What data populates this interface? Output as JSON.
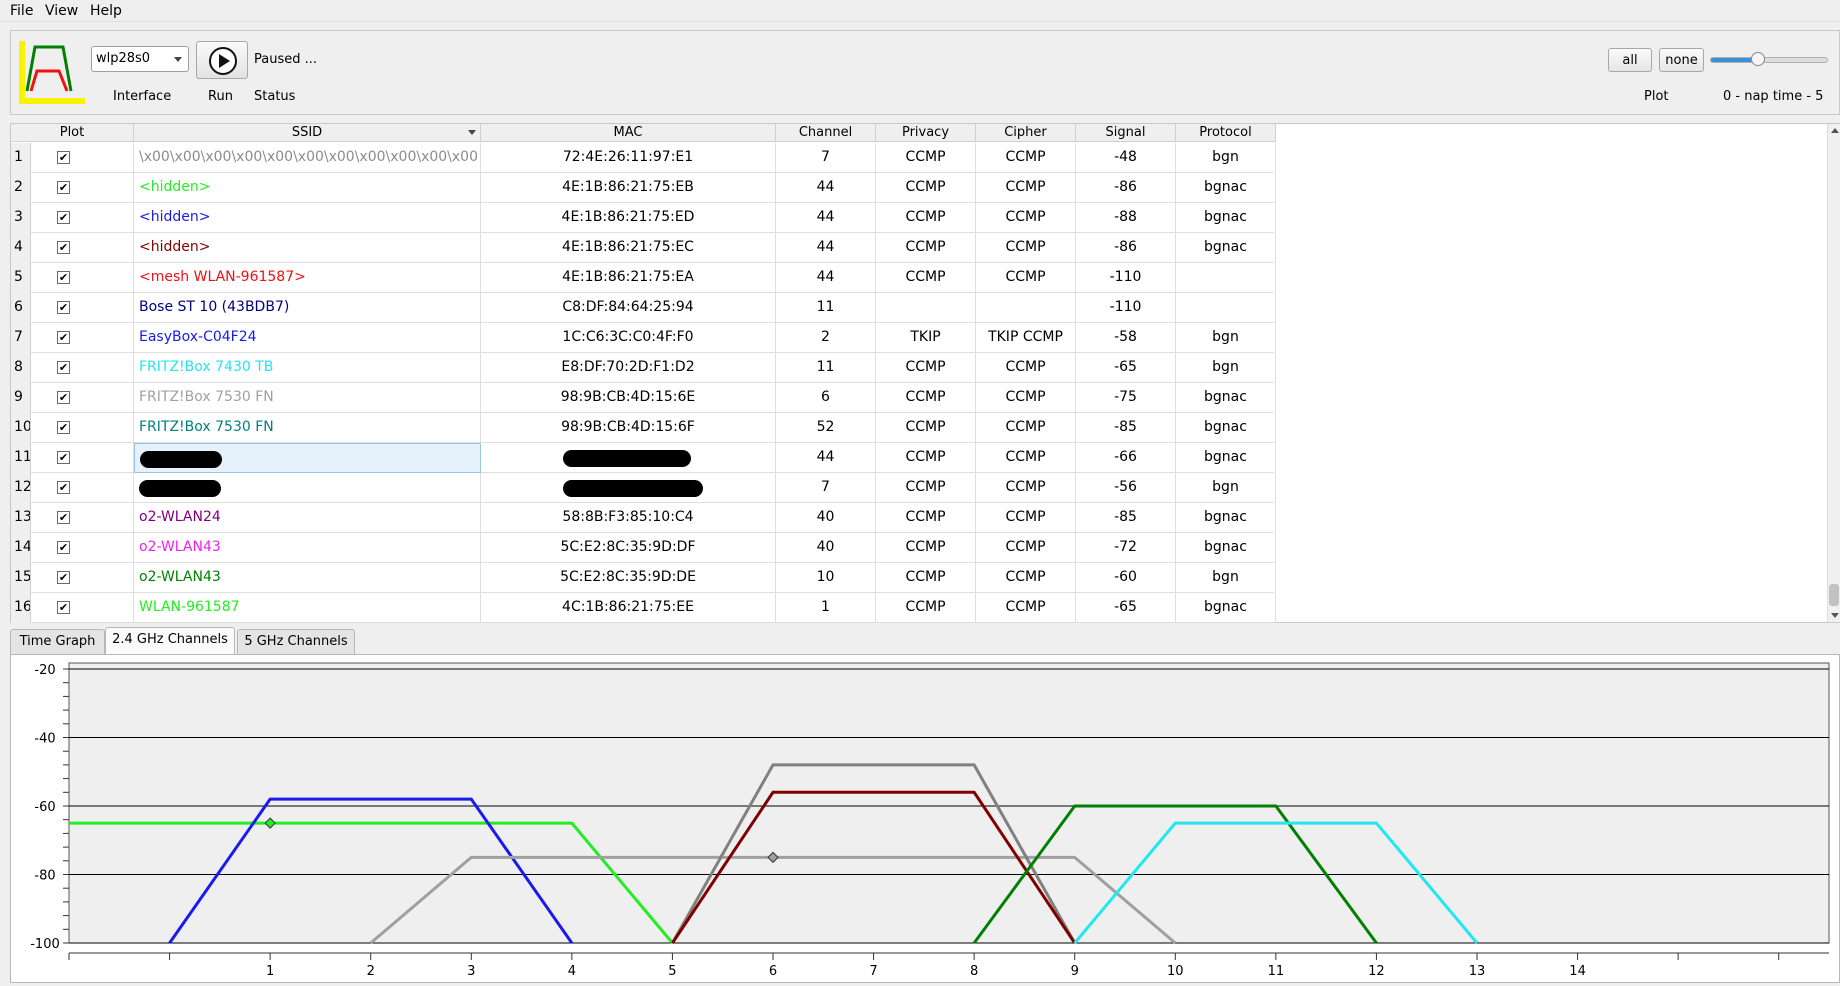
{
  "menu": {
    "file": "File",
    "view": "View",
    "help": "Help"
  },
  "toolbar": {
    "interface_value": "wlp28s0",
    "interface_label": "Interface",
    "run_label": "Run",
    "status_value": "Paused ...",
    "status_label": "Status",
    "all_label": "all",
    "none_label": "none",
    "plot_label": "Plot",
    "nap_time_label": "0 - nap time - 5",
    "nap_time_level": 0.35
  },
  "table": {
    "headers": [
      "Plot",
      "SSID",
      "MAC",
      "Channel",
      "Privacy",
      "Cipher",
      "Signal",
      "Protocol"
    ],
    "rows": [
      {
        "num": "1",
        "ssid": "\\x00\\x00\\x00\\x00\\x00\\x00\\x00\\x00\\x00\\x00\\x00",
        "mac": "72:4E:26:11:97:E1",
        "channel": "7",
        "privacy": "CCMP",
        "cipher": "CCMP",
        "signal": "-48",
        "protocol": "bgn",
        "color": "#8c8c8c"
      },
      {
        "num": "2",
        "ssid": "<hidden>",
        "mac": "4E:1B:86:21:75:EB",
        "channel": "44",
        "privacy": "CCMP",
        "cipher": "CCMP",
        "signal": "-86",
        "protocol": "bgnac",
        "color": "#22ee22"
      },
      {
        "num": "3",
        "ssid": "<hidden>",
        "mac": "4E:1B:86:21:75:ED",
        "channel": "44",
        "privacy": "CCMP",
        "cipher": "CCMP",
        "signal": "-88",
        "protocol": "bgnac",
        "color": "#1a1aee"
      },
      {
        "num": "4",
        "ssid": "<hidden>",
        "mac": "4E:1B:86:21:75:EC",
        "channel": "44",
        "privacy": "CCMP",
        "cipher": "CCMP",
        "signal": "-86",
        "protocol": "bgnac",
        "color": "#800000"
      },
      {
        "num": "5",
        "ssid": "<mesh WLAN-961587>",
        "mac": "4E:1B:86:21:75:EA",
        "channel": "44",
        "privacy": "CCMP",
        "cipher": "CCMP",
        "signal": "-110",
        "protocol": "",
        "color": "#ee1111"
      },
      {
        "num": "6",
        "ssid": "Bose ST 10 (43BDB7)",
        "mac": "C8:DF:84:64:25:94",
        "channel": "11",
        "privacy": "",
        "cipher": "",
        "signal": "-110",
        "protocol": "",
        "color": "#000080"
      },
      {
        "num": "7",
        "ssid": "EasyBox-C04F24",
        "mac": "1C:C6:3C:C0:4F:F0",
        "channel": "2",
        "privacy": "TKIP",
        "cipher": "TKIP CCMP",
        "signal": "-58",
        "protocol": "bgn",
        "color": "#1a1aee"
      },
      {
        "num": "8",
        "ssid": "FRITZ!Box 7430 TB",
        "mac": "E8:DF:70:2D:F1:D2",
        "channel": "11",
        "privacy": "CCMP",
        "cipher": "CCMP",
        "signal": "-65",
        "protocol": "bgn",
        "color": "#22e6f0"
      },
      {
        "num": "9",
        "ssid": "FRITZ!Box 7530 FN",
        "mac": "98:9B:CB:4D:15:6E",
        "channel": "6",
        "privacy": "CCMP",
        "cipher": "CCMP",
        "signal": "-75",
        "protocol": "bgnac",
        "color": "#a0a0a0"
      },
      {
        "num": "10",
        "ssid": "FRITZ!Box 7530 FN",
        "mac": "98:9B:CB:4D:15:6F",
        "channel": "52",
        "privacy": "CCMP",
        "cipher": "CCMP",
        "signal": "-85",
        "protocol": "bgnac",
        "color": "#008080"
      },
      {
        "num": "11",
        "ssid": "",
        "mac": "",
        "channel": "44",
        "privacy": "CCMP",
        "cipher": "CCMP",
        "signal": "-66",
        "protocol": "bgnac",
        "color": "#000000"
      },
      {
        "num": "12",
        "ssid": "",
        "mac": "",
        "channel": "7",
        "privacy": "CCMP",
        "cipher": "CCMP",
        "signal": "-56",
        "protocol": "bgn",
        "color": "#000000"
      },
      {
        "num": "13",
        "ssid": "o2-WLAN24",
        "mac": "58:8B:F3:85:10:C4",
        "channel": "40",
        "privacy": "CCMP",
        "cipher": "CCMP",
        "signal": "-85",
        "protocol": "bgnac",
        "color": "#800080"
      },
      {
        "num": "14",
        "ssid": "o2-WLAN43",
        "mac": "5C:E2:8C:35:9D:DF",
        "channel": "40",
        "privacy": "CCMP",
        "cipher": "CCMP",
        "signal": "-72",
        "protocol": "bgnac",
        "color": "#ee22ee"
      },
      {
        "num": "15",
        "ssid": "o2-WLAN43",
        "mac": "5C:E2:8C:35:9D:DE",
        "channel": "10",
        "privacy": "CCMP",
        "cipher": "CCMP",
        "signal": "-60",
        "protocol": "bgn",
        "color": "#008000"
      },
      {
        "num": "16",
        "ssid": "WLAN-961587",
        "mac": "4C:1B:86:21:75:EE",
        "channel": "1",
        "privacy": "CCMP",
        "cipher": "CCMP",
        "signal": "-65",
        "protocol": "bgnac",
        "color": "#22ee22"
      }
    ]
  },
  "tabs": [
    "Time Graph",
    "2.4 GHz Channels",
    "5 GHz Channels"
  ],
  "active_tab": 1,
  "chart_data": {
    "type": "line",
    "title": "",
    "xlabel": "",
    "ylabel": "",
    "xlim": [
      -1,
      16.5
    ],
    "ylim": [
      -100,
      -20
    ],
    "x_ticks": [
      1,
      2,
      3,
      4,
      5,
      6,
      7,
      8,
      9,
      10,
      11,
      12,
      13,
      14
    ],
    "y_ticks": [
      -20,
      -40,
      -60,
      -80,
      -100
    ],
    "grid": "horizontal",
    "series": [
      {
        "color": "#22ee22",
        "x": [
          -1,
          4,
          5
        ],
        "y": [
          -65,
          -65,
          -100
        ],
        "marker_x": 1,
        "marker_y": -65
      },
      {
        "color": "#1a1aee",
        "x": [
          0,
          1,
          3,
          4
        ],
        "y": [
          -100,
          -58,
          -58,
          -100
        ]
      },
      {
        "color": "#a0a0a0",
        "x": [
          2,
          3,
          9,
          10
        ],
        "y": [
          -100,
          -75,
          -75,
          -100
        ],
        "marker_x": 6,
        "marker_y": -75
      },
      {
        "color": "#808080",
        "x": [
          5,
          6,
          8,
          9
        ],
        "y": [
          -100,
          -48,
          -48,
          -100
        ]
      },
      {
        "color": "#800000",
        "x": [
          5,
          6,
          8,
          9
        ],
        "y": [
          -100,
          -56,
          -56,
          -100
        ]
      },
      {
        "color": "#008000",
        "x": [
          8,
          9,
          11,
          12
        ],
        "y": [
          -100,
          -60,
          -60,
          -100
        ]
      },
      {
        "color": "#22e6f0",
        "x": [
          9,
          10,
          12,
          13
        ],
        "y": [
          -100,
          -65,
          -65,
          -100
        ]
      }
    ]
  }
}
